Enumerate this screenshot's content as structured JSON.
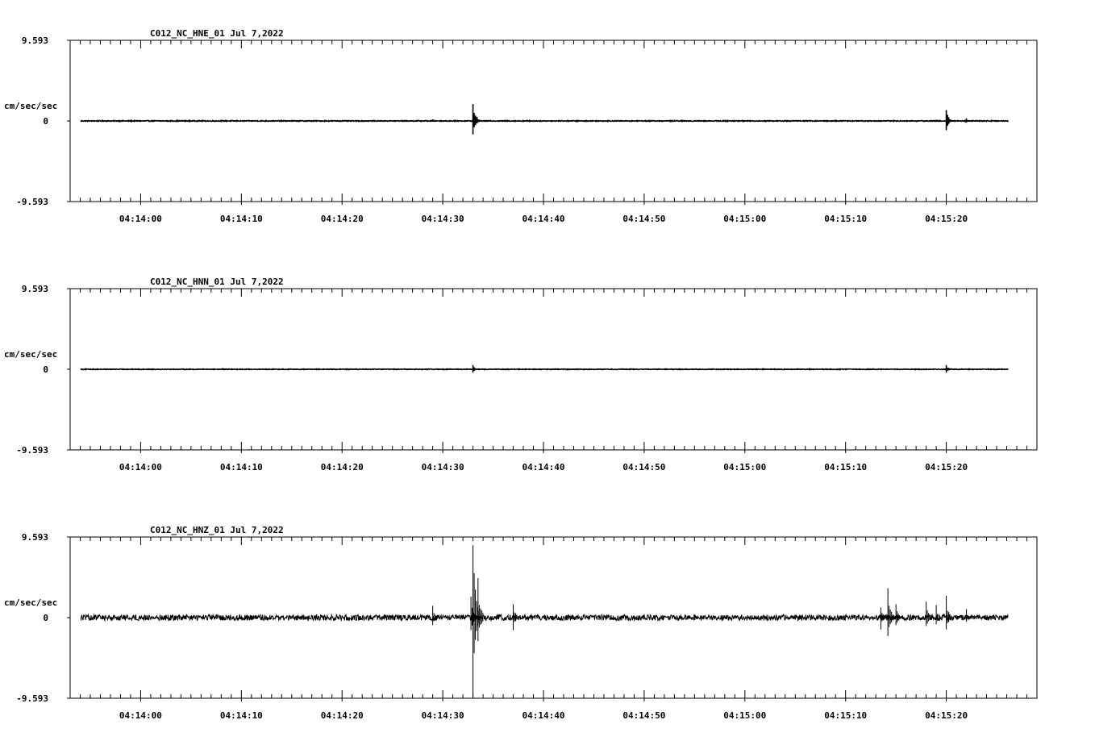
{
  "chart_data": [
    {
      "type": "line",
      "title": "C012_NC_HNE_01   Jul 7,2022",
      "ylabel": "cm/sec/sec",
      "ylim": [
        -9.593,
        9.593
      ],
      "ytick_labels": [
        "9.593",
        "0",
        "-9.593"
      ],
      "xtick_labels": [
        "04:14:00",
        "04:14:10",
        "04:14:20",
        "04:14:30",
        "04:14:40",
        "04:14:50",
        "04:15:00",
        "04:15:10",
        "04:15:20"
      ],
      "xlim_seconds": [
        -7,
        89
      ],
      "grid": false,
      "noise": 0.05,
      "spikes": [
        {
          "t": 33.0,
          "up": 2.0,
          "down": 1.6
        },
        {
          "t": 33.4,
          "up": 0.5,
          "down": 0.3
        },
        {
          "t": 29.0,
          "up": 0.2,
          "down": 0.1
        },
        {
          "t": 80.0,
          "up": 1.3,
          "down": 1.1
        },
        {
          "t": 82.0,
          "up": 0.3,
          "down": 0.2
        }
      ]
    },
    {
      "type": "line",
      "title": "C012_NC_HNN_01   Jul 7,2022",
      "ylabel": "cm/sec/sec",
      "ylim": [
        -9.593,
        9.593
      ],
      "ytick_labels": [
        "9.593",
        "0",
        "-9.593"
      ],
      "xtick_labels": [
        "04:14:00",
        "04:14:10",
        "04:14:20",
        "04:14:30",
        "04:14:40",
        "04:14:50",
        "04:15:00",
        "04:15:10",
        "04:15:20"
      ],
      "xlim_seconds": [
        -7,
        89
      ],
      "grid": false,
      "noise": 0.04,
      "spikes": [
        {
          "t": 33.0,
          "up": 0.5,
          "down": 0.4
        },
        {
          "t": 80.0,
          "up": 0.5,
          "down": 0.4
        }
      ]
    },
    {
      "type": "line",
      "title": "C012_NC_HNZ_01   Jul 7,2022",
      "ylabel": "cm/sec/sec",
      "ylim": [
        -9.593,
        9.593
      ],
      "ytick_labels": [
        "9.593",
        "0",
        "-9.593"
      ],
      "xtick_labels": [
        "04:14:00",
        "04:14:10",
        "04:14:20",
        "04:14:30",
        "04:14:40",
        "04:14:50",
        "04:15:00",
        "04:15:10",
        "04:15:20"
      ],
      "xlim_seconds": [
        -7,
        89
      ],
      "grid": false,
      "noise": 0.35,
      "spikes": [
        {
          "t": 33.0,
          "up": 8.6,
          "down": 9.5
        },
        {
          "t": 33.5,
          "up": 4.7,
          "down": 2.8
        },
        {
          "t": 32.8,
          "up": 2.5,
          "down": 1.5
        },
        {
          "t": 29.0,
          "up": 1.4,
          "down": 0.9
        },
        {
          "t": 37.0,
          "up": 1.6,
          "down": 1.5
        },
        {
          "t": 74.2,
          "up": 3.5,
          "down": 2.2
        },
        {
          "t": 73.5,
          "up": 1.2,
          "down": 1.4
        },
        {
          "t": 75.0,
          "up": 1.6,
          "down": 0.9
        },
        {
          "t": 78.0,
          "up": 1.9,
          "down": 1.0
        },
        {
          "t": 79.0,
          "up": 1.5,
          "down": 0.8
        },
        {
          "t": 80.0,
          "up": 2.6,
          "down": 1.4
        },
        {
          "t": 82.0,
          "up": 1.0,
          "down": 0.5
        }
      ]
    }
  ]
}
